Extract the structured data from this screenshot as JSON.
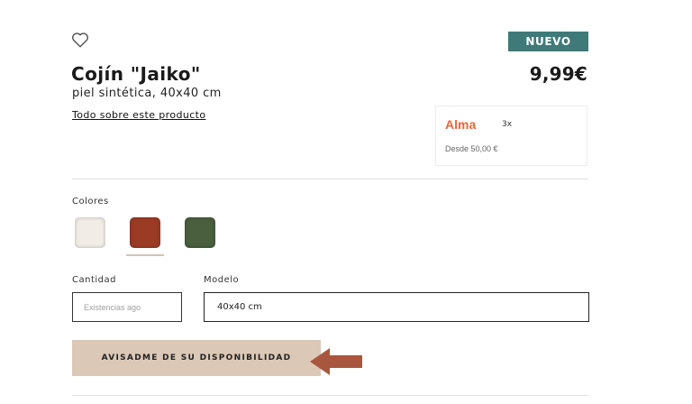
{
  "product": {
    "title": "Cojín \"Jaiko\"",
    "subtitle": "piel sintética, 40x40 cm",
    "about_link": "Todo sobre este producto",
    "badge": "NUEVO",
    "price": "9,99€"
  },
  "alma": {
    "logo": "Alma",
    "installments": "3x",
    "from_text": "Desde 50,00 €"
  },
  "colors": {
    "label": "Colores",
    "options": [
      {
        "color": "#f1ede6",
        "selected": false
      },
      {
        "color": "#9b3b24",
        "selected": true
      },
      {
        "color": "#4a5f3e",
        "selected": false
      }
    ]
  },
  "quantity": {
    "label": "Cantidad",
    "placeholder": "Existencias ago"
  },
  "model": {
    "label": "Modelo",
    "value": "40x40 cm"
  },
  "notify_button": "AVISADME DE SU DISPONIBILIDAD",
  "icons": {
    "favorite": "heart-outline-icon",
    "pointer": "arrow-left-icon"
  },
  "accent_colors": {
    "badge": "#3f7a79",
    "alma": "#e8663a",
    "button": "#dcc8b6",
    "arrow": "#a9563f"
  }
}
